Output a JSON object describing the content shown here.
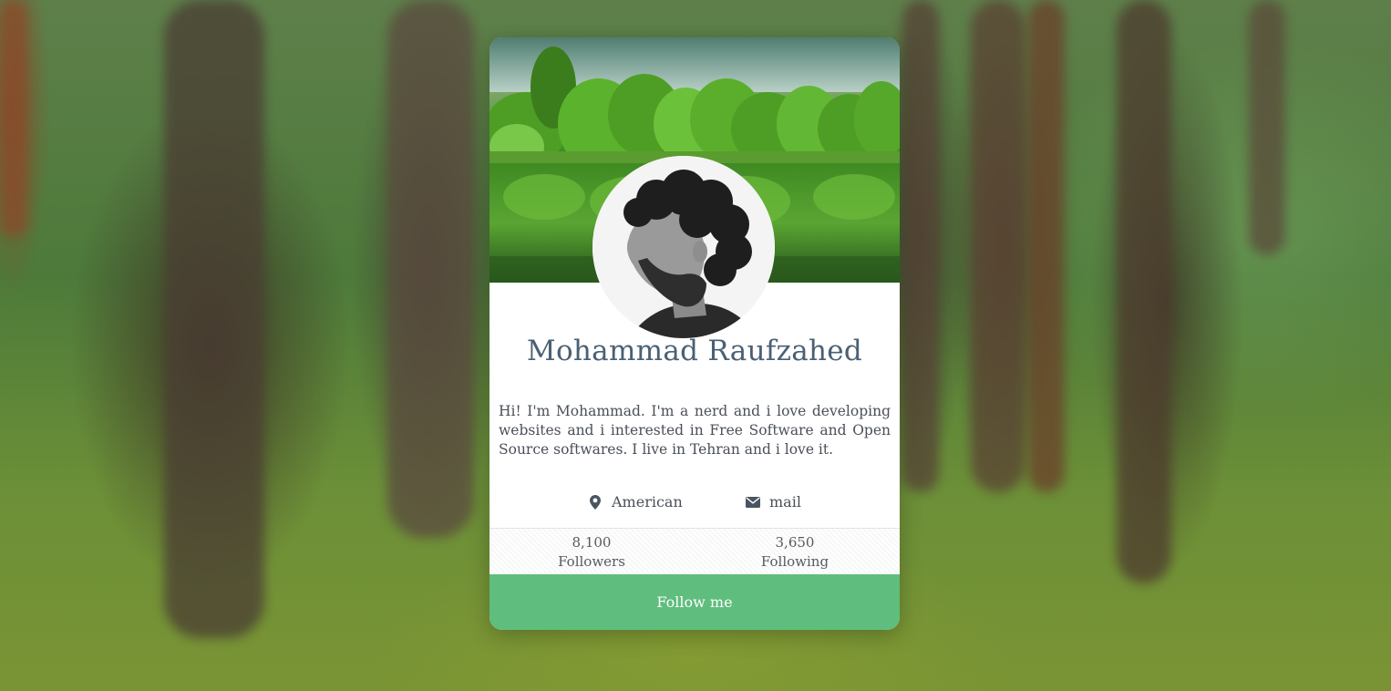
{
  "profile": {
    "name": "Mohammad Raufzahed",
    "bio": "Hi! I'm Mohammad. I'm a nerd and i love developing websites and i interested in Free Software and Open Source softwares. I live in Tehran and i love it.",
    "location": "American",
    "contact": "mail",
    "location_icon": "map-marker-icon",
    "contact_icon": "envelope-icon"
  },
  "stats": {
    "followers_count": "8,100",
    "followers_label": "Followers",
    "following_count": "3,650",
    "following_label": "Following"
  },
  "action": {
    "follow_label": "Follow me"
  },
  "colors": {
    "name_color": "#4a6074",
    "button_color": "#5fbd7d",
    "card_background": "#ffffff"
  }
}
